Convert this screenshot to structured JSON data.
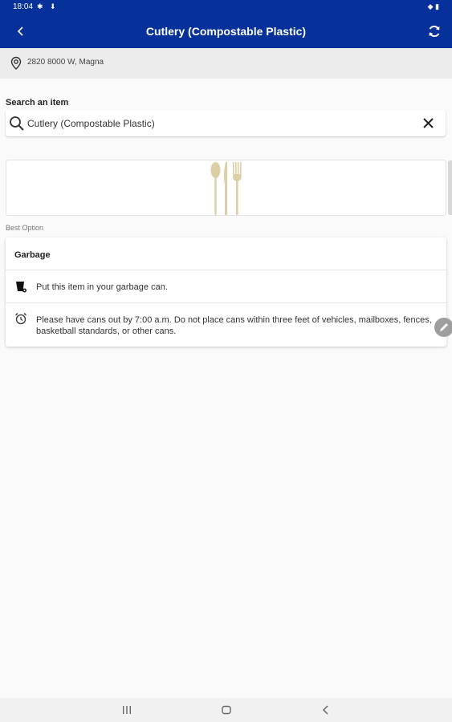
{
  "status_bar": {
    "time": "18:04",
    "left_icons": "✱ ⬇",
    "right_icons": "◆ ▮"
  },
  "app_bar": {
    "title": "Cutlery (Compostable Plastic)",
    "back_icon": "back-arrow-icon",
    "refresh_icon": "refresh-icon",
    "color": "#06319b"
  },
  "location": {
    "icon": "location-pin-icon",
    "address": "2820 8000 W, Magna"
  },
  "search": {
    "label": "Search an item",
    "value": "Cutlery (Compostable Plastic)",
    "icon": "search-icon",
    "clear_icon": "close-icon"
  },
  "item_image": {
    "icon": "cutlery-icon",
    "color": "#dccfa6"
  },
  "best_option": {
    "label": "Best Option",
    "heading": "Garbage",
    "instruction": "Put this item in your garbage can.",
    "instruction_icon": "garbage-can-icon",
    "note": "Please have cans out by 7:00 a.m. Do not place cans within three feet of vehicles, mailboxes, fences, basketball standards, or other cans.",
    "note_icon": "alarm-clock-icon"
  },
  "fab": {
    "icon": "pencil-icon"
  },
  "nav_bar": {
    "recents": "recents-icon",
    "home": "home-icon",
    "back": "back-icon"
  }
}
